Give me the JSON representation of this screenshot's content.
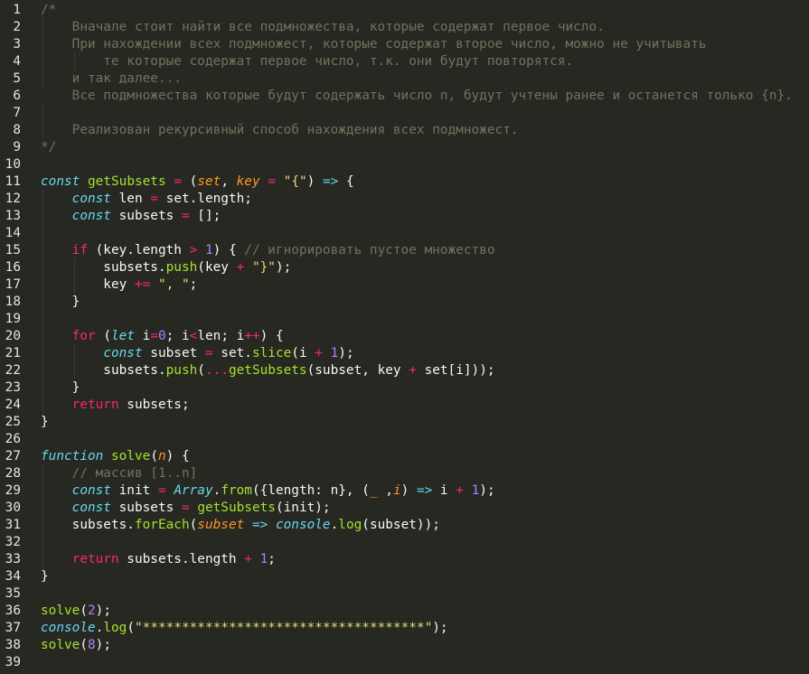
{
  "editor": {
    "theme": {
      "background": "#272822",
      "comment": "#75715e",
      "keyword": "#f92672",
      "function": "#a6e22e",
      "string": "#e6db74",
      "number": "#ae81ff",
      "storage": "#66d9ef",
      "param": "#fd971f",
      "text": "#f8f8f2"
    },
    "lines": [
      [
        {
          "t": "cm",
          "v": "/*"
        }
      ],
      [
        {
          "t": "cm",
          "v": "    Вначале стоит найти все подмножества, которые содержат первое число."
        }
      ],
      [
        {
          "t": "cm",
          "v": "    При нахождении всех подмножест, которые содержат второе число, можно не учитывать"
        }
      ],
      [
        {
          "t": "cm",
          "v": "        те которые содержат первое число, т.к. они будут повторятся."
        }
      ],
      [
        {
          "t": "cm",
          "v": "    и так далее..."
        }
      ],
      [
        {
          "t": "cm",
          "v": "    Все подмножества которые будут содержать число n, будут учтены ранее и останется только {n}."
        }
      ],
      [
        {
          "t": "cm",
          "v": ""
        }
      ],
      [
        {
          "t": "cm",
          "v": "    Реализован рекурсивный способ нахождения всех подмножест."
        }
      ],
      [
        {
          "t": "cm",
          "v": "*/"
        }
      ],
      [],
      [
        {
          "t": "st",
          "v": "const"
        },
        {
          "t": "pl",
          "v": " "
        },
        {
          "t": "fn",
          "v": "getSubsets"
        },
        {
          "t": "pl",
          "v": " "
        },
        {
          "t": "op",
          "v": "="
        },
        {
          "t": "pl",
          "v": " ("
        },
        {
          "t": "pa",
          "v": "set"
        },
        {
          "t": "pl",
          "v": ", "
        },
        {
          "t": "pa",
          "v": "key"
        },
        {
          "t": "pl",
          "v": " "
        },
        {
          "t": "op",
          "v": "="
        },
        {
          "t": "pl",
          "v": " "
        },
        {
          "t": "s",
          "v": "\"{\""
        },
        {
          "t": "pl",
          "v": ") "
        },
        {
          "t": "st",
          "v": "=>"
        },
        {
          "t": "pl",
          "v": " {"
        }
      ],
      [
        {
          "t": "pl",
          "v": "    "
        },
        {
          "t": "st",
          "v": "const"
        },
        {
          "t": "pl",
          "v": " len "
        },
        {
          "t": "op",
          "v": "="
        },
        {
          "t": "pl",
          "v": " set.length;"
        }
      ],
      [
        {
          "t": "pl",
          "v": "    "
        },
        {
          "t": "st",
          "v": "const"
        },
        {
          "t": "pl",
          "v": " subsets "
        },
        {
          "t": "op",
          "v": "="
        },
        {
          "t": "pl",
          "v": " [];"
        }
      ],
      [],
      [
        {
          "t": "pl",
          "v": "    "
        },
        {
          "t": "kw",
          "v": "if"
        },
        {
          "t": "pl",
          "v": " (key.length "
        },
        {
          "t": "op",
          "v": ">"
        },
        {
          "t": "pl",
          "v": " "
        },
        {
          "t": "nu",
          "v": "1"
        },
        {
          "t": "pl",
          "v": ") { "
        },
        {
          "t": "cm",
          "v": "// игнорировать пустое множество"
        }
      ],
      [
        {
          "t": "pl",
          "v": "        subsets."
        },
        {
          "t": "fn",
          "v": "push"
        },
        {
          "t": "pl",
          "v": "(key "
        },
        {
          "t": "op",
          "v": "+"
        },
        {
          "t": "pl",
          "v": " "
        },
        {
          "t": "s",
          "v": "\"}\""
        },
        {
          "t": "pl",
          "v": ");"
        }
      ],
      [
        {
          "t": "pl",
          "v": "        key "
        },
        {
          "t": "op",
          "v": "+="
        },
        {
          "t": "pl",
          "v": " "
        },
        {
          "t": "s",
          "v": "\", \""
        },
        {
          "t": "pl",
          "v": ";"
        }
      ],
      [
        {
          "t": "pl",
          "v": "    }"
        }
      ],
      [],
      [
        {
          "t": "pl",
          "v": "    "
        },
        {
          "t": "kw",
          "v": "for"
        },
        {
          "t": "pl",
          "v": " ("
        },
        {
          "t": "st",
          "v": "let"
        },
        {
          "t": "pl",
          "v": " i"
        },
        {
          "t": "op",
          "v": "="
        },
        {
          "t": "nu",
          "v": "0"
        },
        {
          "t": "pl",
          "v": "; i"
        },
        {
          "t": "op",
          "v": "<"
        },
        {
          "t": "pl",
          "v": "len; i"
        },
        {
          "t": "op",
          "v": "++"
        },
        {
          "t": "pl",
          "v": ") {"
        }
      ],
      [
        {
          "t": "pl",
          "v": "        "
        },
        {
          "t": "st",
          "v": "const"
        },
        {
          "t": "pl",
          "v": " subset "
        },
        {
          "t": "op",
          "v": "="
        },
        {
          "t": "pl",
          "v": " set."
        },
        {
          "t": "fn",
          "v": "slice"
        },
        {
          "t": "pl",
          "v": "(i "
        },
        {
          "t": "op",
          "v": "+"
        },
        {
          "t": "pl",
          "v": " "
        },
        {
          "t": "nu",
          "v": "1"
        },
        {
          "t": "pl",
          "v": ");"
        }
      ],
      [
        {
          "t": "pl",
          "v": "        subsets."
        },
        {
          "t": "fn",
          "v": "push"
        },
        {
          "t": "pl",
          "v": "("
        },
        {
          "t": "op",
          "v": "..."
        },
        {
          "t": "fn",
          "v": "getSubsets"
        },
        {
          "t": "pl",
          "v": "(subset, key "
        },
        {
          "t": "op",
          "v": "+"
        },
        {
          "t": "pl",
          "v": " set[i]));"
        }
      ],
      [
        {
          "t": "pl",
          "v": "    }"
        }
      ],
      [
        {
          "t": "pl",
          "v": "    "
        },
        {
          "t": "kw",
          "v": "return"
        },
        {
          "t": "pl",
          "v": " subsets;"
        }
      ],
      [
        {
          "t": "pl",
          "v": "}"
        }
      ],
      [],
      [
        {
          "t": "st",
          "v": "function"
        },
        {
          "t": "pl",
          "v": " "
        },
        {
          "t": "fn",
          "v": "solve"
        },
        {
          "t": "pl",
          "v": "("
        },
        {
          "t": "pa",
          "v": "n"
        },
        {
          "t": "pl",
          "v": ") {"
        }
      ],
      [
        {
          "t": "pl",
          "v": "    "
        },
        {
          "t": "cm",
          "v": "// массив [1..n]"
        }
      ],
      [
        {
          "t": "pl",
          "v": "    "
        },
        {
          "t": "st",
          "v": "const"
        },
        {
          "t": "pl",
          "v": " init "
        },
        {
          "t": "op",
          "v": "="
        },
        {
          "t": "pl",
          "v": " "
        },
        {
          "t": "cls",
          "v": "Array"
        },
        {
          "t": "pl",
          "v": "."
        },
        {
          "t": "fn",
          "v": "from"
        },
        {
          "t": "pl",
          "v": "({length: n}, ("
        },
        {
          "t": "pa",
          "v": "_"
        },
        {
          "t": "pl",
          "v": " ,"
        },
        {
          "t": "pa",
          "v": "i"
        },
        {
          "t": "pl",
          "v": ") "
        },
        {
          "t": "st",
          "v": "=>"
        },
        {
          "t": "pl",
          "v": " i "
        },
        {
          "t": "op",
          "v": "+"
        },
        {
          "t": "pl",
          "v": " "
        },
        {
          "t": "nu",
          "v": "1"
        },
        {
          "t": "pl",
          "v": ");"
        }
      ],
      [
        {
          "t": "pl",
          "v": "    "
        },
        {
          "t": "st",
          "v": "const"
        },
        {
          "t": "pl",
          "v": " subsets "
        },
        {
          "t": "op",
          "v": "="
        },
        {
          "t": "pl",
          "v": " "
        },
        {
          "t": "fn",
          "v": "getSubsets"
        },
        {
          "t": "pl",
          "v": "(init);"
        }
      ],
      [
        {
          "t": "pl",
          "v": "    subsets."
        },
        {
          "t": "fn",
          "v": "forEach"
        },
        {
          "t": "pl",
          "v": "("
        },
        {
          "t": "pa",
          "v": "subset"
        },
        {
          "t": "pl",
          "v": " "
        },
        {
          "t": "st",
          "v": "=>"
        },
        {
          "t": "pl",
          "v": " "
        },
        {
          "t": "cls",
          "v": "console"
        },
        {
          "t": "pl",
          "v": "."
        },
        {
          "t": "fn",
          "v": "log"
        },
        {
          "t": "pl",
          "v": "(subset));"
        }
      ],
      [],
      [
        {
          "t": "pl",
          "v": "    "
        },
        {
          "t": "kw",
          "v": "return"
        },
        {
          "t": "pl",
          "v": " subsets.length "
        },
        {
          "t": "op",
          "v": "+"
        },
        {
          "t": "pl",
          "v": " "
        },
        {
          "t": "nu",
          "v": "1"
        },
        {
          "t": "pl",
          "v": ";"
        }
      ],
      [
        {
          "t": "pl",
          "v": "}"
        }
      ],
      [],
      [
        {
          "t": "fn",
          "v": "solve"
        },
        {
          "t": "pl",
          "v": "("
        },
        {
          "t": "nu",
          "v": "2"
        },
        {
          "t": "pl",
          "v": ");"
        }
      ],
      [
        {
          "t": "cls",
          "v": "console"
        },
        {
          "t": "pl",
          "v": "."
        },
        {
          "t": "fn",
          "v": "log"
        },
        {
          "t": "pl",
          "v": "("
        },
        {
          "t": "s",
          "v": "\"************************************\""
        },
        {
          "t": "pl",
          "v": ");"
        }
      ],
      [
        {
          "t": "fn",
          "v": "solve"
        },
        {
          "t": "pl",
          "v": "("
        },
        {
          "t": "nu",
          "v": "8"
        },
        {
          "t": "pl",
          "v": ");"
        }
      ],
      []
    ]
  }
}
